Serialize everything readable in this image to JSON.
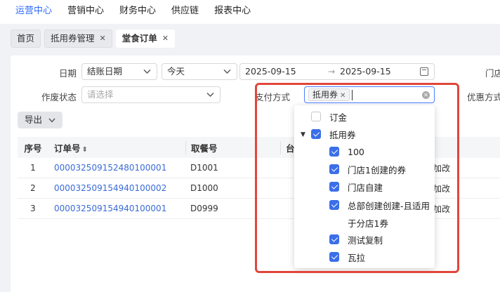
{
  "topnav": {
    "items": [
      "运营中心",
      "营销中心",
      "财务中心",
      "供应链",
      "报表中心"
    ],
    "active": 0
  },
  "tabs": [
    {
      "label": "首页",
      "closable": false
    },
    {
      "label": "抵用券管理",
      "closable": true
    },
    {
      "label": "堂食订单",
      "closable": true,
      "active": true
    }
  ],
  "filters": {
    "date_label": "日期",
    "date_type": "结账日期",
    "date_range": "今天",
    "date_start": "2025-09-15",
    "date_end": "2025-09-15",
    "store_label": "门店",
    "void_label": "作废状态",
    "void_placeholder": "请选择",
    "pay_label": "支付方式",
    "pay_tag": "抵用券",
    "discount_label": "优惠方式"
  },
  "export_label": "导出",
  "table": {
    "headers": [
      "序号",
      "订单号",
      "取餐号",
      "台"
    ],
    "rows": [
      {
        "no": "1",
        "order": "000032509152480100001",
        "pickup": "D1001",
        "tail": "加改"
      },
      {
        "no": "2",
        "order": "000032509154940100002",
        "pickup": "D1000",
        "tail": "加改"
      },
      {
        "no": "3",
        "order": "000032509154940100001",
        "pickup": "D0999",
        "tail": "加改"
      }
    ]
  },
  "dropdown": {
    "options": [
      {
        "label": "订金",
        "checked": false,
        "level": 0
      },
      {
        "label": "抵用券",
        "checked": true,
        "level": 0,
        "expanded": true
      },
      {
        "label": "100",
        "checked": true,
        "level": 1
      },
      {
        "label": "门店1创建的券",
        "checked": true,
        "level": 1
      },
      {
        "label": "门店自建",
        "checked": true,
        "level": 1
      },
      {
        "label": "总部创建创建-且适用",
        "checked": true,
        "level": 1
      },
      {
        "label": "于分店1券",
        "checked": null,
        "level": 1
      },
      {
        "label": "测试复制",
        "checked": true,
        "level": 1
      },
      {
        "label": "瓦拉",
        "checked": true,
        "level": 1
      }
    ]
  },
  "colors": {
    "accent": "#2f6bff",
    "highlight": "#e0463b",
    "link": "#3a6bd6"
  }
}
